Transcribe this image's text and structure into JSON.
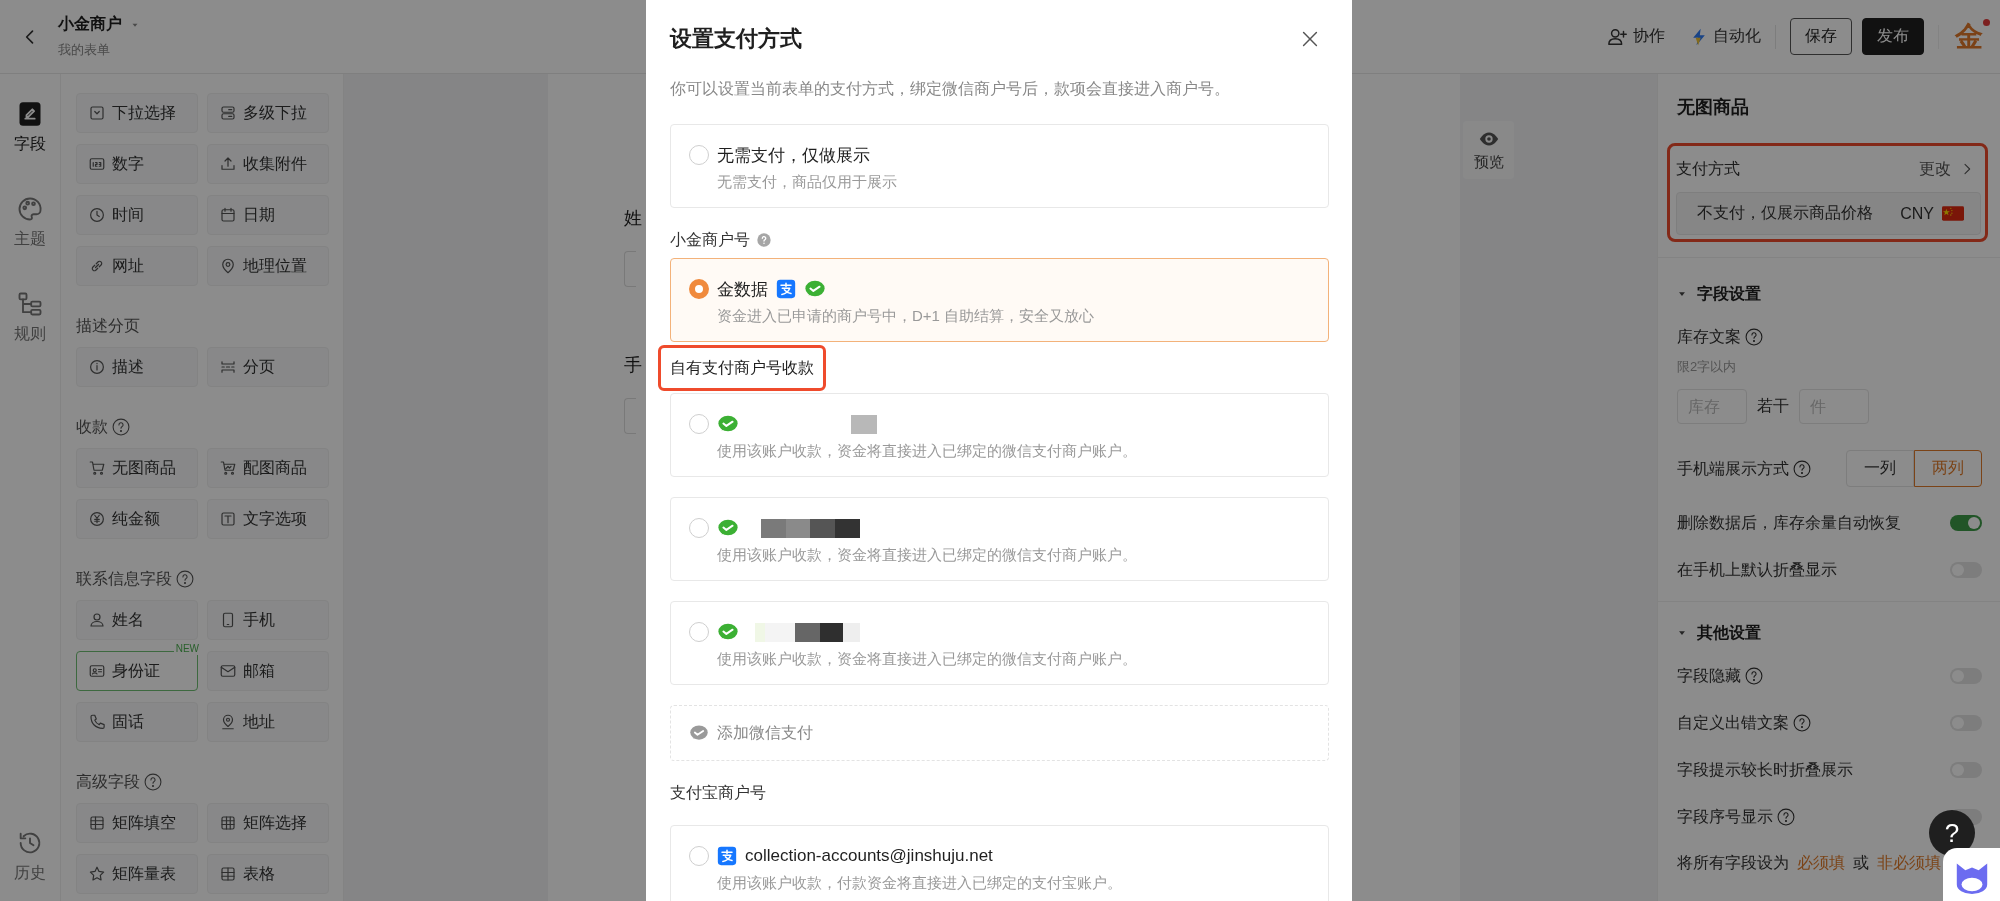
{
  "header": {
    "title": "小金商户",
    "subtitle": "我的表单",
    "actions": [
      {
        "label": "协作",
        "kind": "collab"
      },
      {
        "label": "自动化",
        "kind": "automation"
      }
    ],
    "buttons": [
      {
        "label": "保存",
        "kind": "outline"
      },
      {
        "label": "发布",
        "kind": "primary"
      }
    ],
    "logo": "金"
  },
  "rail": {
    "items": [
      {
        "label": "字段",
        "selected": true
      },
      {
        "label": "主题",
        "selected": false
      },
      {
        "label": "规则",
        "selected": false
      }
    ],
    "footer_items": [
      {
        "label": "历史",
        "selected": false
      }
    ]
  },
  "palette": {
    "sections": [
      {
        "items": [
          {
            "label": "下拉选择"
          },
          {
            "label": "多级下拉"
          },
          {
            "label": "数字"
          },
          {
            "label": "收集附件"
          },
          {
            "label": "时间"
          },
          {
            "label": "日期"
          },
          {
            "label": "网址"
          },
          {
            "label": "地理位置"
          }
        ]
      },
      {
        "title": "描述分页",
        "help": false,
        "items": [
          {
            "label": "描述"
          },
          {
            "label": "分页"
          }
        ]
      },
      {
        "title": "收款",
        "help": true,
        "items": [
          {
            "label": "无图商品"
          },
          {
            "label": "配图商品"
          },
          {
            "label": "纯金额"
          },
          {
            "label": "文字选项"
          }
        ]
      },
      {
        "title": "联系信息字段",
        "help": true,
        "items": [
          {
            "label": "姓名"
          },
          {
            "label": "手机"
          },
          {
            "label": "身份证",
            "badge": "NEW"
          },
          {
            "label": "邮箱"
          },
          {
            "label": "固话"
          },
          {
            "label": "地址"
          }
        ]
      },
      {
        "title": "高级字段",
        "help": true,
        "items": [
          {
            "label": "矩阵填空"
          },
          {
            "label": "矩阵选择"
          },
          {
            "label": "矩阵量表"
          },
          {
            "label": "表格"
          }
        ]
      }
    ]
  },
  "canvas": {
    "field_labels": [
      "姓",
      "手"
    ],
    "preview": "预览"
  },
  "modal": {
    "title": "设置支付方式",
    "description": "你可以设置当前表单的支付方式，绑定微信商户号后，款项会直接进入商户号。",
    "groups": [
      {
        "options": [
          {
            "kind": "plain",
            "title": "无需支付，仅做展示",
            "desc": "无需支付，商品仅用于展示",
            "selected": false
          }
        ]
      },
      {
        "label": "小金商户号",
        "help": true,
        "highlighted": false,
        "options": [
          {
            "kind": "jinshuju",
            "title": "金数据",
            "desc": "资金进入已申请的商户号中，D+1 自助结算，安全又放心",
            "selected": true
          }
        ]
      },
      {
        "label": "自有支付商户号收款",
        "help": false,
        "highlighted": true,
        "options": [
          {
            "kind": "wechat",
            "desc": "使用该账户收款，资金将直接进入已绑定的微信支付商户账户。",
            "selected": false
          },
          {
            "kind": "wechat",
            "desc": "使用该账户收款，资金将直接进入已绑定的微信支付商户账户。",
            "selected": false
          },
          {
            "kind": "wechat",
            "desc": "使用该账户收款，资金将直接进入已绑定的微信支付商户账户。",
            "selected": false
          },
          {
            "kind": "add",
            "title": "添加微信支付"
          }
        ]
      },
      {
        "label": "支付宝商户号",
        "help": false,
        "highlighted": false,
        "options": [
          {
            "kind": "alipay",
            "title": "collection-accounts@jinshuju.net",
            "desc": "使用该账户收款，付款资金将直接进入已绑定的支付宝账户。",
            "selected": false
          }
        ]
      }
    ]
  },
  "panel": {
    "title": "无图商品",
    "payment": {
      "label": "支付方式",
      "action": "更改",
      "value": "不支付，仅展示商品价格",
      "currency": "CNY",
      "highlighted": true
    },
    "sections": [
      {
        "title": "字段设置",
        "expanded": true,
        "rows": [
          {
            "kind": "stock",
            "label": "库存文案",
            "help": true,
            "hint": "限2字以内",
            "fields": [
              {
                "placeholder": "库存"
              },
              {
                "placeholder": "件"
              }
            ],
            "joiner": "若干"
          },
          {
            "kind": "segment",
            "label": "手机端展示方式",
            "help": true,
            "options": [
              {
                "label": "一列",
                "selected": false
              },
              {
                "label": "两列",
                "selected": true
              }
            ]
          },
          {
            "kind": "toggle",
            "label": "删除数据后，库存余量自动恢复",
            "help": false,
            "on": true
          },
          {
            "kind": "toggle",
            "label": "在手机上默认折叠显示",
            "help": false,
            "on": false
          }
        ]
      },
      {
        "title": "其他设置",
        "expanded": true,
        "rows": [
          {
            "kind": "toggle",
            "label": "字段隐藏",
            "help": true,
            "on": false
          },
          {
            "kind": "toggle",
            "label": "自定义出错文案",
            "help": true,
            "on": false
          },
          {
            "kind": "toggle",
            "label": "字段提示较长时折叠展示",
            "help": false,
            "on": false
          },
          {
            "kind": "toggle",
            "label": "字段序号显示",
            "help": true,
            "on": false
          },
          {
            "kind": "links",
            "label": "将所有字段设为",
            "links": [
              "必须填",
              "非必须填"
            ],
            "joiner": "或"
          }
        ]
      }
    ]
  },
  "help_button": "?"
}
